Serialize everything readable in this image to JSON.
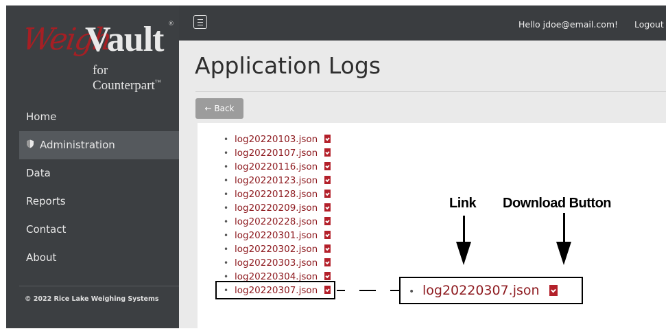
{
  "brand": {
    "logo_weigh": "Weigh",
    "logo_vault": "Vault",
    "logo_sub": "for Counterpart",
    "logo_tm": "®",
    "logo_sub_tm": "™"
  },
  "sidebar": {
    "items": [
      {
        "label": "Home"
      },
      {
        "label": "Administration",
        "icon": "shield-icon",
        "active": true
      },
      {
        "label": "Data"
      },
      {
        "label": "Reports"
      },
      {
        "label": "Contact"
      },
      {
        "label": "About"
      }
    ],
    "copyright": "© 2022 Rice Lake Weighing Systems"
  },
  "header": {
    "menu_icon": "hamburger-menu-icon",
    "greeting": "Hello jdoe@email.com!",
    "logout": "Logout"
  },
  "main": {
    "title": "Application Logs",
    "back_label": "← Back",
    "logs": [
      "log20220103.json",
      "log20220107.json",
      "log20220116.json",
      "log20220123.json",
      "log20220128.json",
      "log20220209.json",
      "log20220228.json",
      "log20220301.json",
      "log20220302.json",
      "log20220303.json",
      "log20220304.json",
      "log20220307.json"
    ],
    "download_icon": "file-download-icon"
  },
  "annotation": {
    "link_label": "Link",
    "download_label": "Download Button",
    "zoom_item": "log20220307.json"
  },
  "colors": {
    "sidebar_bg": "#3c3f42",
    "active_item_bg": "#55595d",
    "link": "#8e1b20",
    "download_icon": "#b3202a",
    "brand_red": "#a61f24"
  }
}
